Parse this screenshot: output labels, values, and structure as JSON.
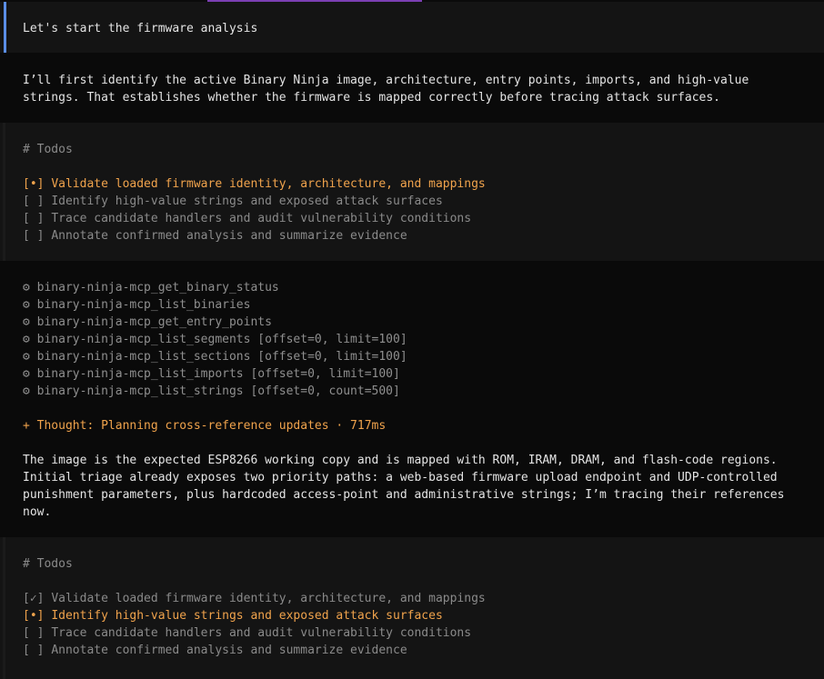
{
  "user_message": "Let's start the firmware analysis",
  "intro_lines": [
    "I’ll first identify the active Binary Ninja image, architecture, entry points, imports, and high-value",
    "strings. That establishes whether the firmware is mapped correctly before tracing attack surfaces."
  ],
  "todos_1": {
    "heading": "# Todos",
    "items": [
      {
        "marker": "[•]",
        "text": "Validate loaded firmware identity, architecture, and mappings",
        "state": "active"
      },
      {
        "marker": "[ ]",
        "text": "Identify high-value strings and exposed attack surfaces",
        "state": "pending"
      },
      {
        "marker": "[ ]",
        "text": "Trace candidate handlers and audit vulnerability conditions",
        "state": "pending"
      },
      {
        "marker": "[ ]",
        "text": "Annotate confirmed analysis and summarize evidence",
        "state": "pending"
      }
    ]
  },
  "tool_calls": [
    {
      "icon": "⚙",
      "name": "binary-ninja-mcp_get_binary_status",
      "args": ""
    },
    {
      "icon": "⚙",
      "name": "binary-ninja-mcp_list_binaries",
      "args": ""
    },
    {
      "icon": "⚙",
      "name": "binary-ninja-mcp_get_entry_points",
      "args": ""
    },
    {
      "icon": "⚙",
      "name": "binary-ninja-mcp_list_segments",
      "args": "[offset=0, limit=100]"
    },
    {
      "icon": "⚙",
      "name": "binary-ninja-mcp_list_sections",
      "args": "[offset=0, limit=100]"
    },
    {
      "icon": "⚙",
      "name": "binary-ninja-mcp_list_imports",
      "args": "[offset=0, limit=100]"
    },
    {
      "icon": "⚙",
      "name": "binary-ninja-mcp_list_strings",
      "args": "[offset=0, count=500]"
    }
  ],
  "thought": {
    "toggle": "+",
    "label": "Thought: Planning cross-reference updates",
    "separator": "·",
    "duration": "717ms"
  },
  "response_lines": [
    "The image is the expected ESP8266 working copy and is mapped with ROM, IRAM, DRAM, and flash-code regions.",
    "Initial triage already exposes two priority paths: a web-based firmware upload endpoint and UDP-controlled",
    "punishment parameters, plus hardcoded access-point and administrative strings; I’m tracing their references",
    "now."
  ],
  "todos_2": {
    "heading": "# Todos",
    "items": [
      {
        "marker": "[✓]",
        "text": "Validate loaded firmware identity, architecture, and mappings",
        "state": "done"
      },
      {
        "marker": "[•]",
        "text": "Identify high-value strings and exposed attack surfaces",
        "state": "active"
      },
      {
        "marker": "[ ]",
        "text": "Trace candidate handlers and audit vulnerability conditions",
        "state": "pending"
      },
      {
        "marker": "[ ]",
        "text": "Annotate confirmed analysis and summarize evidence",
        "state": "pending"
      }
    ]
  },
  "colors": {
    "background": "#0a0a0a",
    "panel": "#141414",
    "user_accent": "#5b8ee6",
    "active_todo": "#f0a34c",
    "muted": "#8a8a8a",
    "progress_accent": "#7b3fb3"
  }
}
